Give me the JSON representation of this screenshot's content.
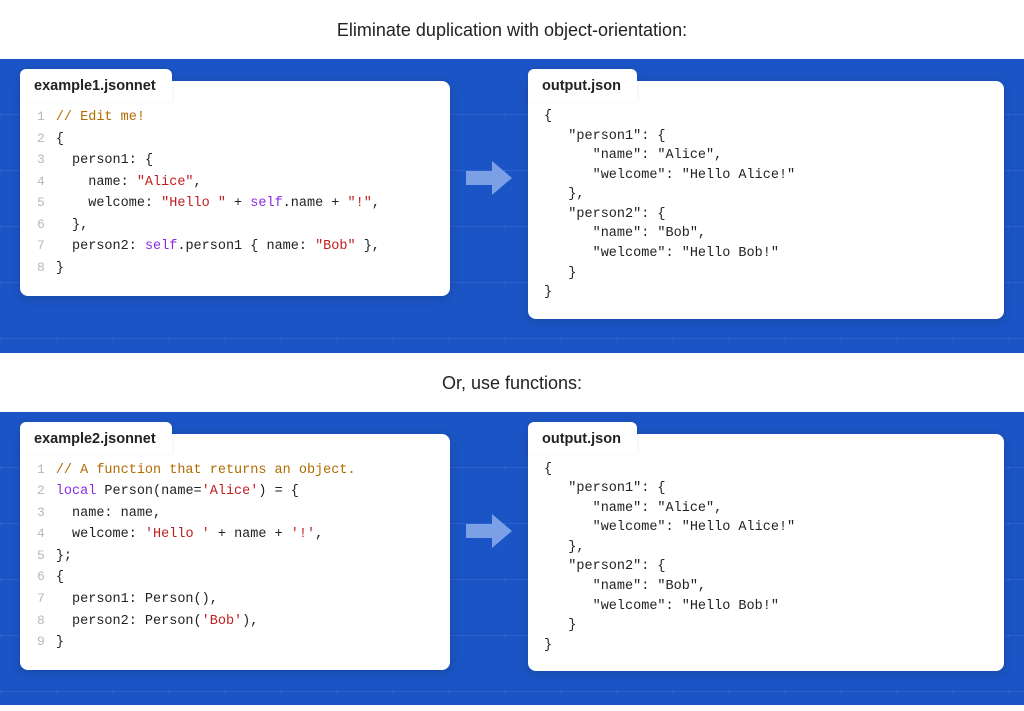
{
  "section1": {
    "heading": "Eliminate duplication with object-orientation:",
    "input": {
      "filename": "example1.jsonnet",
      "lines": [
        [
          {
            "t": "comment",
            "v": "// Edit me!"
          }
        ],
        [
          {
            "t": "punc",
            "v": "{"
          }
        ],
        [
          {
            "t": "ident",
            "v": "  person1: "
          },
          {
            "t": "punc",
            "v": "{"
          }
        ],
        [
          {
            "t": "ident",
            "v": "    name: "
          },
          {
            "t": "str",
            "v": "\"Alice\""
          },
          {
            "t": "punc",
            "v": ","
          }
        ],
        [
          {
            "t": "ident",
            "v": "    welcome: "
          },
          {
            "t": "str",
            "v": "\"Hello \""
          },
          {
            "t": "op",
            "v": " + "
          },
          {
            "t": "key",
            "v": "self"
          },
          {
            "t": "ident",
            "v": ".name"
          },
          {
            "t": "op",
            "v": " + "
          },
          {
            "t": "str",
            "v": "\"!\""
          },
          {
            "t": "punc",
            "v": ","
          }
        ],
        [
          {
            "t": "punc",
            "v": "  },"
          }
        ],
        [
          {
            "t": "ident",
            "v": "  person2: "
          },
          {
            "t": "key",
            "v": "self"
          },
          {
            "t": "ident",
            "v": ".person1 "
          },
          {
            "t": "punc",
            "v": "{ "
          },
          {
            "t": "ident",
            "v": "name: "
          },
          {
            "t": "str",
            "v": "\"Bob\""
          },
          {
            "t": "punc",
            "v": " },"
          }
        ],
        [
          {
            "t": "punc",
            "v": "}"
          }
        ]
      ]
    },
    "output": {
      "filename": "output.json",
      "text": "{\n   \"person1\": {\n      \"name\": \"Alice\",\n      \"welcome\": \"Hello Alice!\"\n   },\n   \"person2\": {\n      \"name\": \"Bob\",\n      \"welcome\": \"Hello Bob!\"\n   }\n}"
    }
  },
  "section2": {
    "heading": "Or, use functions:",
    "input": {
      "filename": "example2.jsonnet",
      "lines": [
        [
          {
            "t": "comment",
            "v": "// A function that returns an object."
          }
        ],
        [
          {
            "t": "key",
            "v": "local"
          },
          {
            "t": "ident",
            "v": " Person(name="
          },
          {
            "t": "str",
            "v": "'Alice'"
          },
          {
            "t": "ident",
            "v": ") = "
          },
          {
            "t": "punc",
            "v": "{"
          }
        ],
        [
          {
            "t": "ident",
            "v": "  name: name,"
          }
        ],
        [
          {
            "t": "ident",
            "v": "  welcome: "
          },
          {
            "t": "str",
            "v": "'Hello '"
          },
          {
            "t": "op",
            "v": " + "
          },
          {
            "t": "ident",
            "v": "name"
          },
          {
            "t": "op",
            "v": " + "
          },
          {
            "t": "str",
            "v": "'!'"
          },
          {
            "t": "punc",
            "v": ","
          }
        ],
        [
          {
            "t": "punc",
            "v": "};"
          }
        ],
        [
          {
            "t": "punc",
            "v": "{"
          }
        ],
        [
          {
            "t": "ident",
            "v": "  person1: Person(),"
          }
        ],
        [
          {
            "t": "ident",
            "v": "  person2: Person("
          },
          {
            "t": "str",
            "v": "'Bob'"
          },
          {
            "t": "ident",
            "v": "),"
          }
        ],
        [
          {
            "t": "punc",
            "v": "}"
          }
        ]
      ]
    },
    "output": {
      "filename": "output.json",
      "text": "{\n   \"person1\": {\n      \"name\": \"Alice\",\n      \"welcome\": \"Hello Alice!\"\n   },\n   \"person2\": {\n      \"name\": \"Bob\",\n      \"welcome\": \"Hello Bob!\"\n   }\n}"
    }
  }
}
